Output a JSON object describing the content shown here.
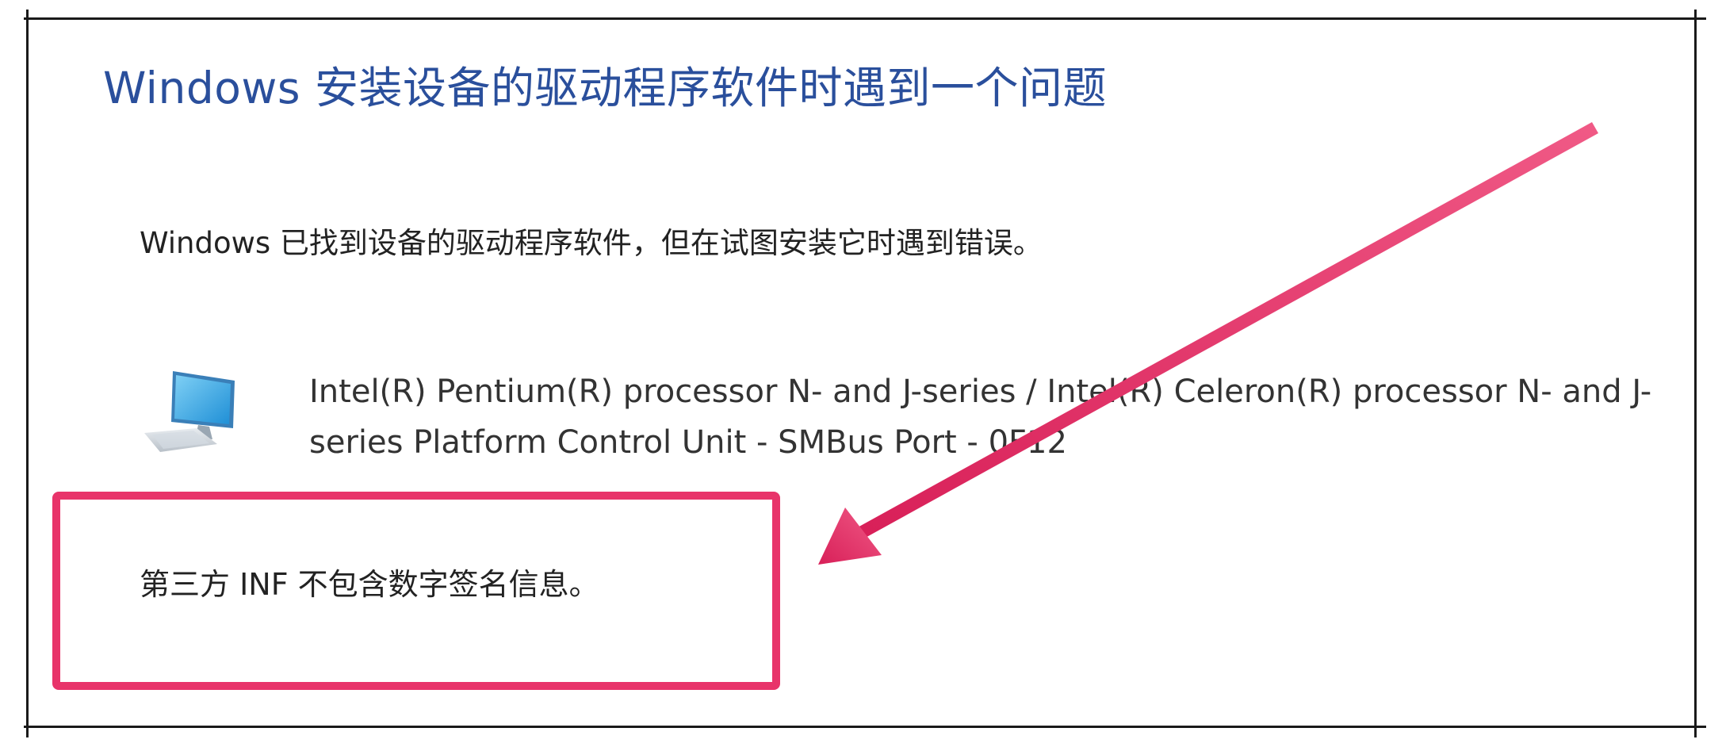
{
  "dialog": {
    "title": "Windows 安装设备的驱动程序软件时遇到一个问题",
    "description": "Windows 已找到设备的驱动程序软件，但在试图安装它时遇到错误。",
    "device": {
      "icon": "computer-icon",
      "name": "Intel(R) Pentium(R) processor N- and J-series / Intel(R) Celeron(R) processor N- and J-series Platform Control Unit - SMBus Port - 0F12"
    },
    "error_message": "第三方 INF 不包含数字签名信息。"
  },
  "annotation": {
    "highlight_color": "#e8346a",
    "arrow_color": "#e8346a",
    "arrow_icon": "pointer-arrow-icon"
  }
}
